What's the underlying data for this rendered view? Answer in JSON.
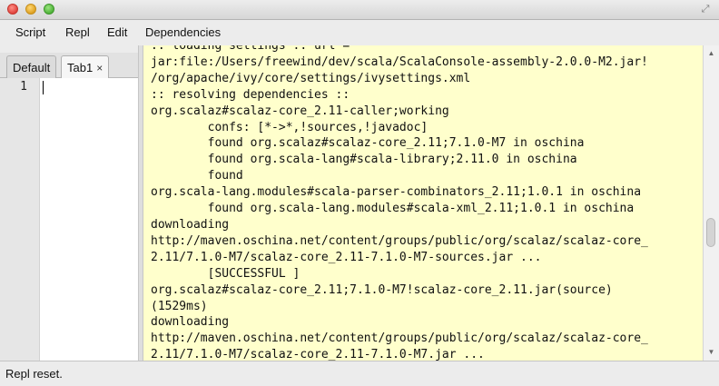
{
  "window": {
    "controls": [
      "close",
      "minimize",
      "zoom"
    ],
    "fullscreen_icon": "⤢"
  },
  "menubar": {
    "items": [
      {
        "label": "Script"
      },
      {
        "label": "Repl"
      },
      {
        "label": "Edit"
      },
      {
        "label": "Dependencies"
      }
    ]
  },
  "tabs": {
    "items": [
      {
        "label": "Default",
        "active": false
      },
      {
        "label": "Tab1",
        "active": true,
        "close_glyph": "×"
      }
    ]
  },
  "editor": {
    "line_number": "1",
    "content": ""
  },
  "console": {
    "lines": [
      ":: loading settings :: url =",
      "jar:file:/Users/freewind/dev/scala/ScalaConsole-assembly-2.0.0-M2.jar!",
      "/org/apache/ivy/core/settings/ivysettings.xml",
      ":: resolving dependencies ::",
      "org.scalaz#scalaz-core_2.11-caller;working",
      "        confs: [*->*,!sources,!javadoc]",
      "        found org.scalaz#scalaz-core_2.11;7.1.0-M7 in oschina",
      "        found org.scala-lang#scala-library;2.11.0 in oschina",
      "        found",
      "org.scala-lang.modules#scala-parser-combinators_2.11;1.0.1 in oschina",
      "        found org.scala-lang.modules#scala-xml_2.11;1.0.1 in oschina",
      "downloading",
      "http://maven.oschina.net/content/groups/public/org/scalaz/scalaz-core_",
      "2.11/7.1.0-M7/scalaz-core_2.11-7.1.0-M7-sources.jar ...",
      "        [SUCCESSFUL ]",
      "org.scalaz#scalaz-core_2.11;7.1.0-M7!scalaz-core_2.11.jar(source)",
      "(1529ms)",
      "downloading",
      "http://maven.oschina.net/content/groups/public/org/scalaz/scalaz-core_",
      "2.11/7.1.0-M7/scalaz-core_2.11-7.1.0-M7.jar ..."
    ],
    "background": "#ffffcc"
  },
  "scrollbar": {
    "up_icon": "▲",
    "down_icon": "▼"
  },
  "status": {
    "text": "Repl reset."
  }
}
